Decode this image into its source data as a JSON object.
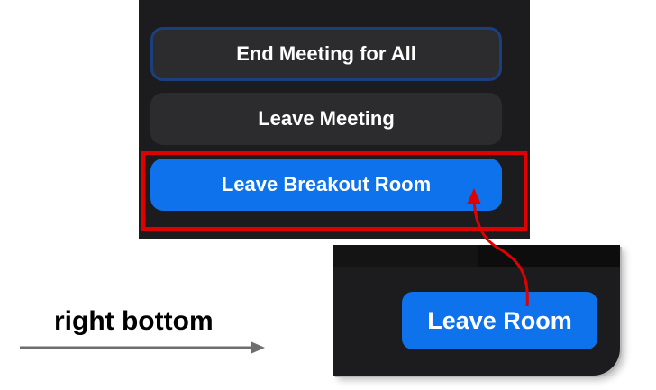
{
  "leave_panel": {
    "end_meeting_label": "End Meeting for All",
    "leave_meeting_label": "Leave Meeting",
    "leave_breakout_label": "Leave Breakout Room"
  },
  "window_corner": {
    "leave_room_label": "Leave Room"
  },
  "annotation": {
    "label": "right bottom"
  },
  "colors": {
    "panel_bg": "#1c1c1e",
    "button_dark": "#2c2c2e",
    "accent_blue": "#0e72ed",
    "highlight_red": "#e00000"
  },
  "icons": [
    "arrow-right-icon",
    "curved-arrow-up-icon"
  ]
}
